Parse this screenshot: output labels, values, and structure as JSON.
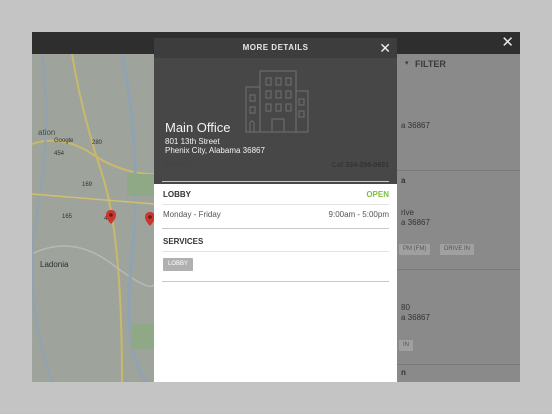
{
  "modal": {
    "title": "MORE DETAILS",
    "close_label": "✕",
    "office": {
      "name": "Main Office",
      "address_line1": "801 13th Street",
      "address_line2": "Phenix City, Alabama 36867"
    },
    "branch_label": "BRANCH",
    "call_prefix": "Call",
    "phone": "334-298-0691",
    "lobby": {
      "label": "LOBBY",
      "status": "OPEN",
      "days": "Monday - Friday",
      "hours": "9:00am - 5:00pm"
    },
    "services": {
      "label": "SERVICES",
      "items": [
        "LOBBY"
      ]
    }
  },
  "background": {
    "close_label": "✕",
    "filter_label": "FILTER",
    "map": {
      "labels": [
        "Ladonia",
        "Google",
        "ation",
        "280",
        "431",
        "165",
        "454",
        "169"
      ]
    },
    "list_fragments": [
      "a 36867",
      "a",
      "rive",
      "a 36867",
      "PM (FM)",
      "DRIVE IN",
      "80",
      "a 36867",
      "IN",
      "n"
    ]
  }
}
